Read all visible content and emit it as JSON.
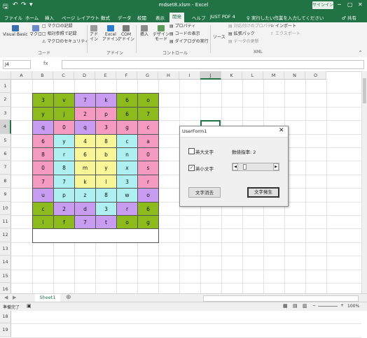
{
  "window": {
    "title": "mdset8.xlsm - Excel",
    "signin_label": "サインイン",
    "minimize": "─",
    "restore": "▢",
    "close": "✕"
  },
  "quick_access": {
    "save": "🖫",
    "undo": "↶",
    "redo": "↷",
    "customize": "▾"
  },
  "ribbon_tabs": [
    "ファイル",
    "ホーム",
    "挿入",
    "ページ レイアウト",
    "数式",
    "データ",
    "校閲",
    "表示",
    "開発",
    "ヘルプ",
    "JUST PDF 4",
    "♀ 実行したい作業を入力してください",
    "♂ 共有"
  ],
  "ribbon": {
    "visual_basic": "Visual Basic",
    "macro": "マクロ",
    "record_macro": "マクロの記録",
    "relative_ref": "相対参照で記録",
    "macro_security": "マクロのセキュリティ",
    "group_code": "コード",
    "addin": "アド\nイン",
    "excel_addin": "Excel\nアドイン",
    "com_addin": "COM\nアドイン",
    "group_addin": "アドイン",
    "insert": "挿入",
    "design_mode": "デザイン\nモード",
    "properties": "プロパティ",
    "view_code": "コードの表示",
    "run_dialog": "ダイアログの実行",
    "group_control": "コントロール",
    "source": "ソース",
    "map_properties": "対応付けのプロパティ",
    "expansion_pack": "拡張パック",
    "refresh_data": "データの更新",
    "import": "インポート",
    "export": "エクスポート",
    "group_xml": "XML"
  },
  "formula_bar": {
    "name_box": "J4",
    "fx": "fx",
    "value": ""
  },
  "columns": [
    "A",
    "B",
    "C",
    "D",
    "E",
    "F",
    "G",
    "H",
    "I",
    "J",
    "K",
    "L",
    "M",
    "N",
    "O"
  ],
  "rows": [
    "1",
    "2",
    "3",
    "4",
    "5",
    "6",
    "7",
    "8",
    "9",
    "10",
    "11",
    "12",
    "13",
    "14",
    "15",
    "16",
    "17",
    "18",
    "19"
  ],
  "colors": {
    "green": "#8dba1c",
    "pink": "#f59ac0",
    "purple": "#c89cf0",
    "yellow": "#f9f69a",
    "cyan": "#aef0f2",
    "excel_green": "#217346"
  },
  "grid": [
    [
      [
        "3",
        "green"
      ],
      [
        "v",
        "green"
      ],
      [
        "7",
        "purple"
      ],
      [
        "k",
        "purple"
      ],
      [
        "6",
        "green"
      ],
      [
        "o",
        "green"
      ]
    ],
    [
      [
        "y",
        "green"
      ],
      [
        "j",
        "green"
      ],
      [
        "2",
        "pink"
      ],
      [
        "p",
        "pink"
      ],
      [
        "6",
        "green"
      ],
      [
        "7",
        "green"
      ]
    ],
    [
      [
        "q",
        "purple"
      ],
      [
        "0",
        "pink"
      ],
      [
        "q",
        "purple"
      ],
      [
        "3",
        "pink"
      ],
      [
        "g",
        "pink"
      ],
      [
        "c",
        "pink"
      ]
    ],
    [
      [
        "6",
        "pink"
      ],
      [
        "y",
        "cyan"
      ],
      [
        "4",
        "yellow"
      ],
      [
        "8",
        "yellow"
      ],
      [
        "c",
        "cyan"
      ],
      [
        "a",
        "pink"
      ]
    ],
    [
      [
        "8",
        "pink"
      ],
      [
        "r",
        "cyan"
      ],
      [
        "6",
        "yellow"
      ],
      [
        "b",
        "yellow"
      ],
      [
        "n",
        "cyan"
      ],
      [
        "0",
        "pink"
      ]
    ],
    [
      [
        "0",
        "pink"
      ],
      [
        "8",
        "cyan"
      ],
      [
        "m",
        "yellow"
      ],
      [
        "y",
        "yellow"
      ],
      [
        "x",
        "cyan"
      ],
      [
        "s",
        "pink"
      ]
    ],
    [
      [
        "7",
        "pink"
      ],
      [
        "7",
        "cyan"
      ],
      [
        "k",
        "yellow"
      ],
      [
        "l",
        "yellow"
      ],
      [
        "3",
        "cyan"
      ],
      [
        "r",
        "pink"
      ]
    ],
    [
      [
        "u",
        "purple"
      ],
      [
        "p",
        "cyan"
      ],
      [
        "z",
        "cyan"
      ],
      [
        "8",
        "cyan"
      ],
      [
        "w",
        "cyan"
      ],
      [
        "o",
        "purple"
      ]
    ],
    [
      [
        "c",
        "green"
      ],
      [
        "2",
        "purple"
      ],
      [
        "d",
        "purple"
      ],
      [
        "3",
        "cyan"
      ],
      [
        "r",
        "purple"
      ],
      [
        "6",
        "green"
      ]
    ],
    [
      [
        "i",
        "green"
      ],
      [
        "f",
        "green"
      ],
      [
        "7",
        "purple"
      ],
      [
        "t",
        "purple"
      ],
      [
        "o",
        "green"
      ],
      [
        "g",
        "green"
      ]
    ]
  ],
  "dialog": {
    "title": "UserForm1",
    "close": "✕",
    "chk_upper_label": "英大文字",
    "chk_upper_checked": false,
    "chk_lower_label": "英小文字",
    "chk_lower_checked": true,
    "check_mark": "✓",
    "number_rate_label": "数値指率: 2",
    "scroll_left": "◀",
    "scroll_right": "▶",
    "number_rate_value": 2,
    "clear_button": "文字消去",
    "generate_button": "文字発生"
  },
  "sheet_tabs": [
    "Sheet1"
  ],
  "add_sheet": "⊕",
  "status": {
    "ready": "準備完了",
    "zoom": "100%",
    "zoom_minus": "−",
    "zoom_plus": "+"
  }
}
